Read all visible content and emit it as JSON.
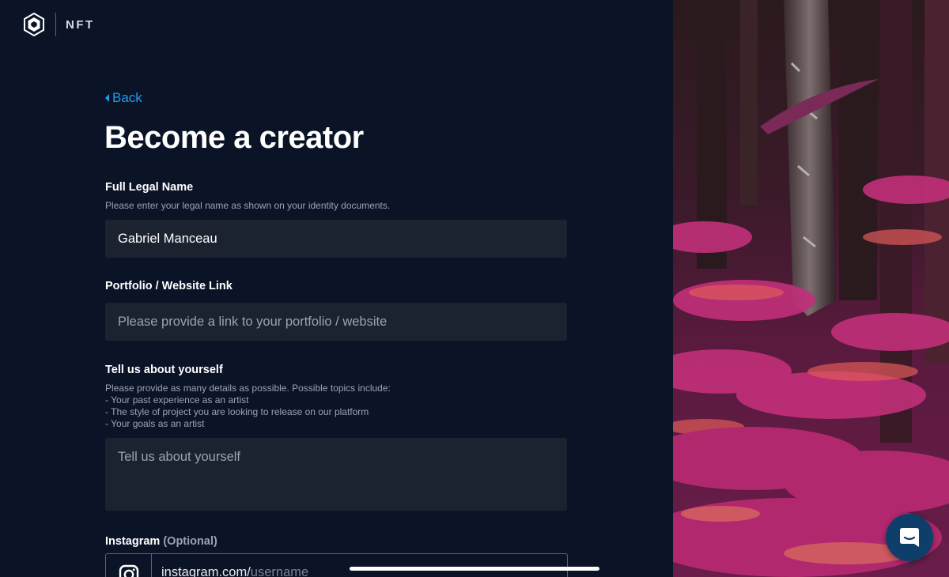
{
  "brand": {
    "logo_icon": "crypto-com-shield-icon",
    "name": "NFT"
  },
  "nav": {
    "back_label": "Back"
  },
  "page": {
    "title": "Become a creator"
  },
  "form": {
    "full_name": {
      "label": "Full Legal Name",
      "hint": "Please enter your legal name as shown on your identity documents.",
      "value": "Gabriel Manceau",
      "placeholder": ""
    },
    "portfolio": {
      "label": "Portfolio / Website Link",
      "value": "",
      "placeholder": "Please provide a link to your portfolio / website"
    },
    "about": {
      "label": "Tell us about yourself",
      "hint_lines": [
        "Please provide as many details as possible. Possible topics include:",
        "- Your past experience as an artist",
        "- The style of project you are looking to release on our platform",
        "- Your goals as an artist"
      ],
      "value": "",
      "placeholder": "Tell us about yourself"
    },
    "instagram": {
      "label": "Instagram",
      "optional_label": "(Optional)",
      "icon": "instagram-icon",
      "prefix": "instagram.com/",
      "placeholder": "username"
    }
  },
  "chat": {
    "icon": "chat-bubble-icon"
  },
  "colors": {
    "background": "#0b1426",
    "field_bg": "#1b2331",
    "accent": "#1f9cf0",
    "muted_text": "#9aa3b2"
  }
}
